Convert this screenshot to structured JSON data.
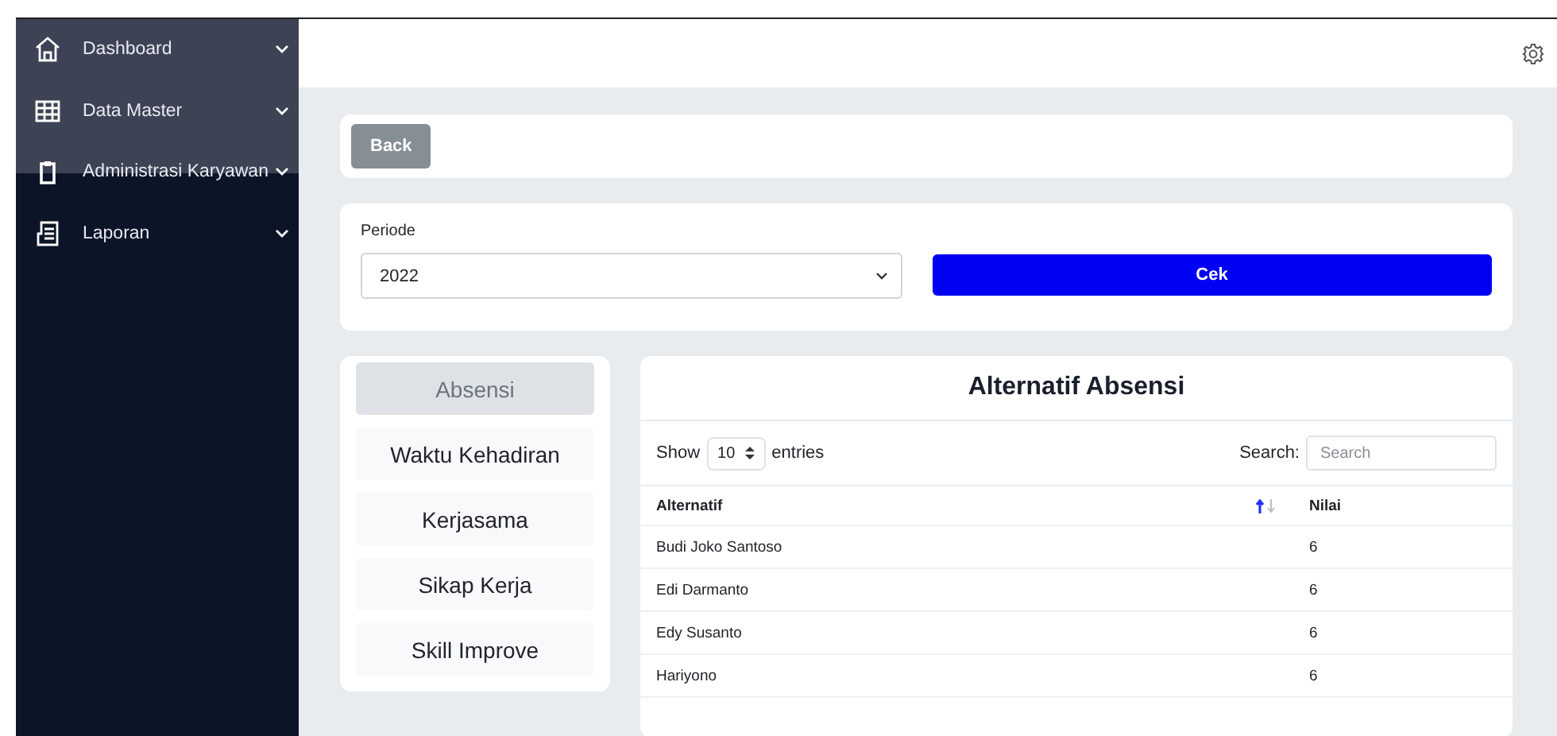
{
  "sidebar": {
    "items": [
      {
        "label": "Dashboard"
      },
      {
        "label": "Data Master"
      },
      {
        "label": "Administrasi Karyawan"
      },
      {
        "label": "Laporan"
      }
    ]
  },
  "back_button": "Back",
  "filter": {
    "label": "Periode",
    "value": "2022",
    "button": "Cek"
  },
  "criteria": [
    {
      "label": "Absensi",
      "selected": true
    },
    {
      "label": "Waktu Kehadiran",
      "selected": false
    },
    {
      "label": "Kerjasama",
      "selected": false
    },
    {
      "label": "Sikap Kerja",
      "selected": false
    },
    {
      "label": "Skill Improve",
      "selected": false
    }
  ],
  "table": {
    "title": "Alternatif Absensi",
    "show_label": "Show",
    "page_size": "10",
    "entries_label": "entries",
    "search_label": "Search:",
    "search_placeholder": "Search",
    "columns": [
      "Alternatif",
      "Nilai"
    ],
    "rows": [
      [
        "Budi Joko Santoso",
        "6"
      ],
      [
        "Edi Darmanto",
        "6"
      ],
      [
        "Edy Susanto",
        "6"
      ],
      [
        "Hariyono",
        "6"
      ]
    ]
  }
}
